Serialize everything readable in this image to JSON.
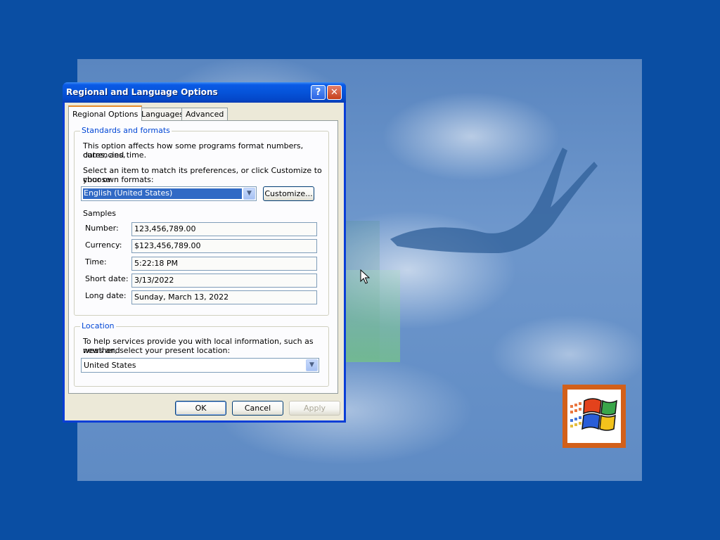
{
  "desktop": {
    "logo_icon": "windows-flag-icon",
    "cursor_icon": "arrow-cursor-icon"
  },
  "dialog": {
    "title": "Regional and Language Options",
    "help_icon": "?",
    "close_icon": "✕",
    "tabs": [
      {
        "label": "Regional Options",
        "selected": true
      },
      {
        "label": "Languages",
        "selected": false
      },
      {
        "label": "Advanced",
        "selected": false
      }
    ],
    "standards": {
      "group_label": "Standards and formats",
      "desc_line1": "This option affects how some programs format numbers, currencies,",
      "desc_line2": "dates, and time.",
      "select_line1": "Select an item to match its preferences, or click Customize to choose",
      "select_line2": "your own formats:",
      "format_value": "English (United States)",
      "customize_label": "Customize...",
      "samples_label": "Samples",
      "samples": [
        {
          "label": "Number:",
          "value": "123,456,789.00"
        },
        {
          "label": "Currency:",
          "value": "$123,456,789.00"
        },
        {
          "label": "Time:",
          "value": "5:22:18 PM"
        },
        {
          "label": "Short date:",
          "value": "3/13/2022"
        },
        {
          "label": "Long date:",
          "value": "Sunday, March 13, 2022"
        }
      ]
    },
    "location": {
      "group_label": "Location",
      "desc_line1": "To help services provide you with local information, such as news and",
      "desc_line2": "weather, select your present location:",
      "value": "United States"
    },
    "buttons": {
      "ok": "OK",
      "cancel": "Cancel",
      "apply": "Apply"
    }
  },
  "colors": {
    "desktop_bg": "#0a4ea3",
    "titlebar": "#0553d9",
    "dialog_face": "#ece9d8",
    "group_label": "#0046d5",
    "selection": "#316ac5",
    "logo_border": "#d2601a"
  }
}
